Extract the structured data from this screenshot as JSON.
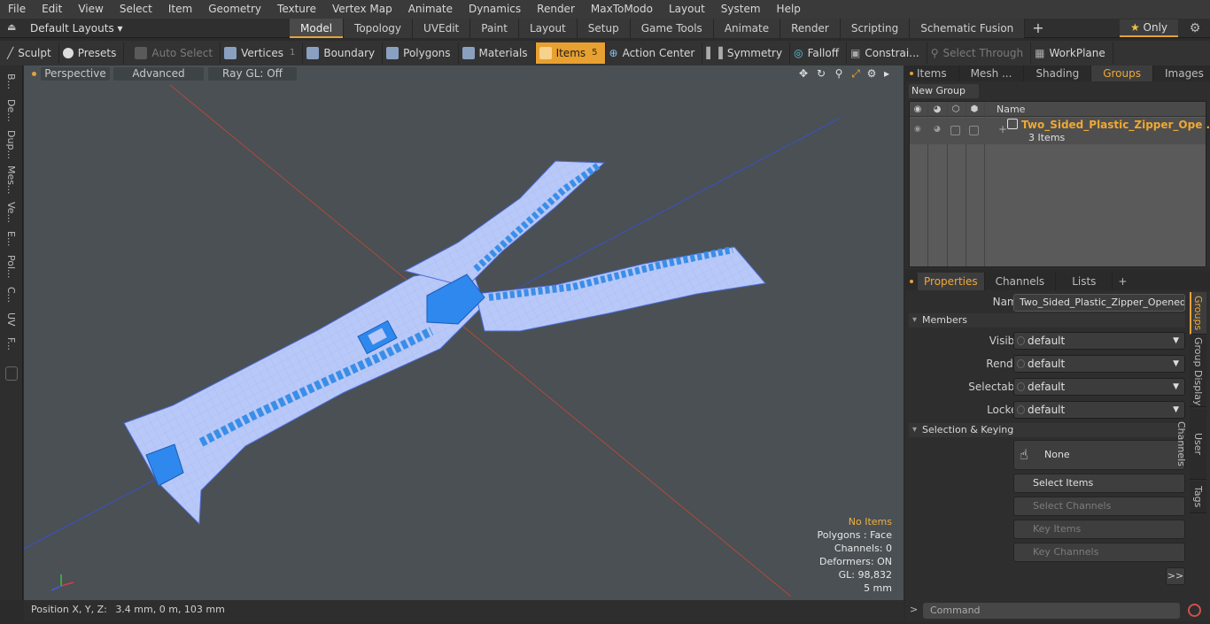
{
  "menu": [
    "File",
    "Edit",
    "View",
    "Select",
    "Item",
    "Geometry",
    "Texture",
    "Vertex Map",
    "Animate",
    "Dynamics",
    "Render",
    "MaxToModo",
    "Layout",
    "System",
    "Help"
  ],
  "layout_bar": {
    "layouts": "Default Layouts ▾",
    "tabs": [
      "Model",
      "Topology",
      "UVEdit",
      "Paint",
      "Layout",
      "Setup",
      "Game Tools",
      "Animate",
      "Render",
      "Scripting",
      "Schematic Fusion"
    ],
    "active_tab": "Model",
    "only_label": "Only"
  },
  "toolbar": {
    "sculpt": "Sculpt",
    "presets": "Presets",
    "auto_select": "Auto Select",
    "vertices": "Vertices",
    "vertices_count": "1",
    "boundary": "Boundary",
    "polygons": "Polygons",
    "materials": "Materials",
    "items": "Items",
    "items_count": "5",
    "action_center": "Action Center",
    "symmetry": "Symmetry",
    "falloff": "Falloff",
    "constraints": "Constrai...",
    "select_through": "Select Through",
    "workplane": "WorkPlane"
  },
  "left_strip": [
    "B...",
    "De...",
    "Dup...",
    "Mes...",
    "Ve...",
    "E...",
    "Pol...",
    "C...",
    "UV",
    "F..."
  ],
  "viewport": {
    "perspective": "Perspective",
    "advanced": "Advanced",
    "ray_gl": "Ray GL: Off",
    "info": {
      "no_items": "No Items",
      "polygons": "Polygons : Face",
      "channels": "Channels: 0",
      "deformers": "Deformers: ON",
      "gl": "GL: 98,832",
      "scale": "5 mm"
    }
  },
  "status": {
    "position_label": "Position X, Y, Z:",
    "position_value": "3.4 mm, 0 m, 103 mm"
  },
  "items_panel": {
    "tabs": [
      "Items",
      "Mesh ...",
      "Shading",
      "Groups",
      "Images"
    ],
    "active_tab": "Groups",
    "new_group": "New Group",
    "name_header": "Name",
    "group_name": "Two_Sided_Plastic_Zipper_Ope ...",
    "group_count": "3 Items"
  },
  "properties": {
    "tabs": [
      "Properties",
      "Channels",
      "Lists"
    ],
    "active_tab": "Properties",
    "name_label": "Name",
    "name_value": "Two_Sided_Plastic_Zipper_Opened_Bl",
    "members_section": "Members",
    "visible_label": "Visible",
    "visible_value": "default",
    "render_label": "Render",
    "render_value": "default",
    "selectable_label": "Selectable",
    "selectable_value": "default",
    "locked_label": "Locked",
    "locked_value": "default",
    "selkey_section": "Selection & Keying",
    "none_btn": "None",
    "select_items": "Select Items",
    "select_channels": "Select Channels",
    "key_items": "Key Items",
    "key_channels": "Key Channels",
    "more": ">>"
  },
  "side_tabs": [
    "Groups",
    "Group Display",
    "User Channels",
    "Tags"
  ],
  "command": {
    "prompt": ">",
    "placeholder": "Command"
  },
  "colors": {
    "accent": "#e5a23a",
    "zipper_fabric": "#b8c8f8",
    "zipper_teeth": "#3a8ee8",
    "viewport_bg": "#4a5054"
  }
}
